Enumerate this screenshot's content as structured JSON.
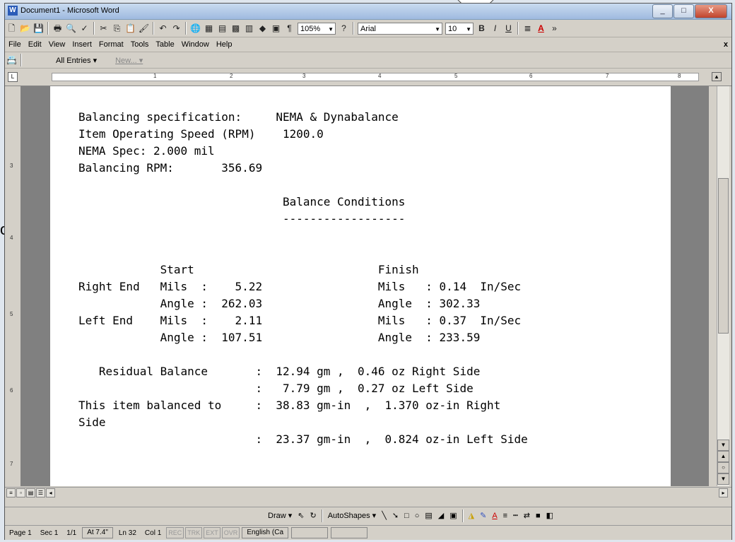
{
  "window": {
    "title": "Document1 - Microsoft Word",
    "icon": "word-icon",
    "minimize": "_",
    "maximize": "□",
    "close": "X"
  },
  "toolbar": {
    "zoom": "105%",
    "font": "Arial",
    "font_size": "10",
    "bold": "B",
    "italic": "I",
    "underline": "U",
    "pilcrow": "¶"
  },
  "menu": [
    "File",
    "Edit",
    "View",
    "Insert",
    "Format",
    "Tools",
    "Table",
    "Window",
    "Help"
  ],
  "menu_close": "x",
  "autotext": {
    "all_entries": "All Entries ▾",
    "new": "New... ▾"
  },
  "ruler_marks": [
    "1",
    "2",
    "3",
    "4",
    "5",
    "6",
    "7",
    "8"
  ],
  "vruler_marks": [
    "3",
    "4",
    "5",
    "6",
    "7"
  ],
  "document_lines": [
    "Balancing specification:     NEMA & Dynabalance",
    "Item Operating Speed (RPM)    1200.0",
    "NEMA Spec: 2.000 mil",
    "Balancing RPM:       356.69",
    "",
    "                              Balance Conditions",
    "                              ------------------",
    "",
    "",
    "",
    "            Start                           Finish",
    "Right End   Mils  :    5.22                 Mils   : 0.14  In/Sec",
    "            Angle :  262.03                 Angle  : 302.33",
    "Left End    Mils  :    2.11                 Mils   : 0.37  In/Sec",
    "            Angle :  107.51                 Angle  : 233.59",
    "",
    "   Residual Balance       :  12.94 gm ,  0.46 oz Right Side",
    "                          :   7.79 gm ,  0.27 oz Left Side",
    "This item balanced to     :  38.83 gm-in  ,  1.370 oz-in Right",
    "Side",
    "                          :  23.37 gm-in  ,  0.824 oz-in Left Side"
  ],
  "drawing": {
    "draw": "Draw ▾",
    "autoshapes": "AutoShapes ▾"
  },
  "status": {
    "page": "Page 1",
    "sec": "Sec 1",
    "pages": "1/1",
    "at": "At 7.4\"",
    "ln": "Ln 32",
    "col": "Col 1",
    "rec": "REC",
    "trk": "TRK",
    "ext": "EXT",
    "ovr": "OVR",
    "language": "English (Ca"
  },
  "background_text": "o"
}
